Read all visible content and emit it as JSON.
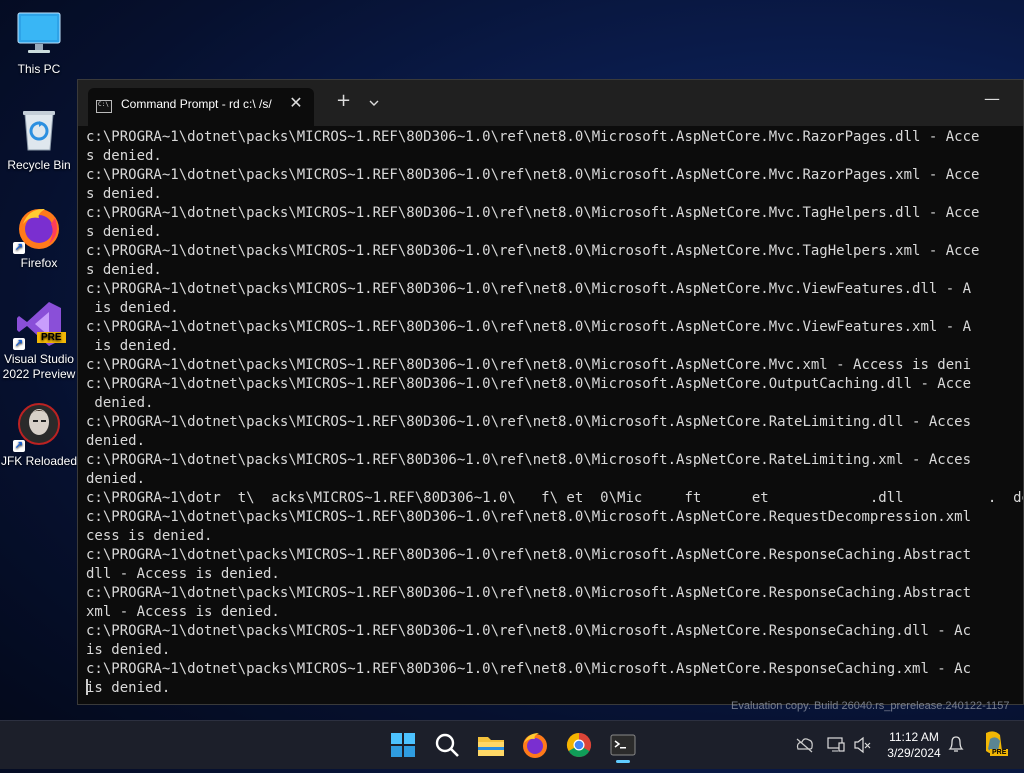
{
  "desktop": {
    "icons": [
      {
        "label": "This PC",
        "icon": "monitor-icon"
      },
      {
        "label": "Recycle Bin",
        "icon": "recycle-bin-icon"
      },
      {
        "label": "Firefox",
        "icon": "firefox-icon"
      },
      {
        "label": "Visual Studio 2022 Preview",
        "label_line1": "Visual Studio",
        "label_line2": "2022 Preview",
        "badge": "PRE",
        "icon": "visual-studio-icon"
      },
      {
        "label": "JFK Reloaded",
        "icon": "jfk-reloaded-icon"
      }
    ],
    "watermark": "Evaluation copy. Build 26040.rs_prerelease.240122-1157"
  },
  "window": {
    "tab_title": "Command Prompt - rd  c:\\ /s/",
    "new_tab_label": "+",
    "minimize_label": "—",
    "terminal_lines": [
      "c:\\PROGRA~1\\dotnet\\packs\\MICROS~1.REF\\80D306~1.0\\ref\\net8.0\\Microsoft.AspNetCore.Mvc.RazorPages.dll - Acce",
      "s denied.",
      "c:\\PROGRA~1\\dotnet\\packs\\MICROS~1.REF\\80D306~1.0\\ref\\net8.0\\Microsoft.AspNetCore.Mvc.RazorPages.xml - Acce",
      "s denied.",
      "c:\\PROGRA~1\\dotnet\\packs\\MICROS~1.REF\\80D306~1.0\\ref\\net8.0\\Microsoft.AspNetCore.Mvc.TagHelpers.dll - Acce",
      "s denied.",
      "c:\\PROGRA~1\\dotnet\\packs\\MICROS~1.REF\\80D306~1.0\\ref\\net8.0\\Microsoft.AspNetCore.Mvc.TagHelpers.xml - Acce",
      "s denied.",
      "c:\\PROGRA~1\\dotnet\\packs\\MICROS~1.REF\\80D306~1.0\\ref\\net8.0\\Microsoft.AspNetCore.Mvc.ViewFeatures.dll - A",
      " is denied.",
      "c:\\PROGRA~1\\dotnet\\packs\\MICROS~1.REF\\80D306~1.0\\ref\\net8.0\\Microsoft.AspNetCore.Mvc.ViewFeatures.xml - A",
      " is denied.",
      "c:\\PROGRA~1\\dotnet\\packs\\MICROS~1.REF\\80D306~1.0\\ref\\net8.0\\Microsoft.AspNetCore.Mvc.xml - Access is deni",
      "c:\\PROGRA~1\\dotnet\\packs\\MICROS~1.REF\\80D306~1.0\\ref\\net8.0\\Microsoft.AspNetCore.OutputCaching.dll - Acce",
      " denied.",
      "c:\\PROGRA~1\\dotnet\\packs\\MICROS~1.REF\\80D306~1.0\\ref\\net8.0\\Microsoft.AspNetCore.RateLimiting.dll - Acces",
      "denied.",
      "c:\\PROGRA~1\\dotnet\\packs\\MICROS~1.REF\\80D306~1.0\\ref\\net8.0\\Microsoft.AspNetCore.RateLimiting.xml - Acces",
      "denied.",
      "c:\\PROGRA~1\\dotr  t\\  acks\\MICROS~1.REF\\80D306~1.0\\   f\\ et  0\\Mic     ft      et            .dll          .  de",
      "c:\\PROGRA~1\\dotnet\\packs\\MICROS~1.REF\\80D306~1.0\\ref\\net8.0\\Microsoft.AspNetCore.RequestDecompression.xml",
      "cess is denied.",
      "c:\\PROGRA~1\\dotnet\\packs\\MICROS~1.REF\\80D306~1.0\\ref\\net8.0\\Microsoft.AspNetCore.ResponseCaching.Abstract",
      "dll - Access is denied.",
      "c:\\PROGRA~1\\dotnet\\packs\\MICROS~1.REF\\80D306~1.0\\ref\\net8.0\\Microsoft.AspNetCore.ResponseCaching.Abstract",
      "xml - Access is denied.",
      "c:\\PROGRA~1\\dotnet\\packs\\MICROS~1.REF\\80D306~1.0\\ref\\net8.0\\Microsoft.AspNetCore.ResponseCaching.dll - Ac",
      "is denied.",
      "c:\\PROGRA~1\\dotnet\\packs\\MICROS~1.REF\\80D306~1.0\\ref\\net8.0\\Microsoft.AspNetCore.ResponseCaching.xml - Ac",
      "is denied."
    ]
  },
  "taskbar": {
    "apps": [
      "start-icon",
      "search-icon",
      "file-explorer-icon",
      "firefox-icon",
      "chrome-icon",
      "terminal-icon"
    ],
    "clock_time": "11:12 AM",
    "clock_date": "3/29/2024",
    "tray_icons": [
      "cloud-offline-icon",
      "display-icon",
      "volume-muted-icon",
      "notification-bell-icon",
      "copilot-icon"
    ],
    "copilot_badge": "PRE"
  },
  "colors": {
    "terminal_bg": "#0c0c0c",
    "terminal_fg": "#d9d9d9",
    "titlebar": "#202020",
    "taskbar": "#1c1f2a",
    "accent": "#60cdff"
  }
}
